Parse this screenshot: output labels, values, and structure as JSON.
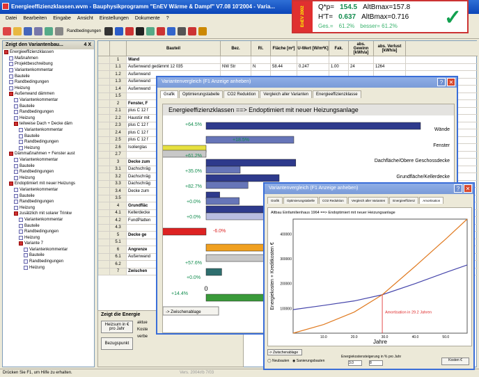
{
  "app": {
    "title": "Energieeffizienzklassen.wvm - Bauphysikprogramm \"EnEV Wärme & Dampf\" V7.08 10'2004 - Varia..."
  },
  "menu": [
    "Datei",
    "Bearbeiten",
    "Eingabe",
    "Ansicht",
    "Einstellungen",
    "Dokumente",
    "?"
  ],
  "toolbar": {
    "randbedingungen_label": "Randbedingungen"
  },
  "infobox": {
    "q_label": "Q*p=",
    "q_value": "154.5",
    "altb1_label": "AltBmax=157.8",
    "ht_label": "H'T=",
    "ht_value": "0.637",
    "altb2_label": "AltBmax=0.716",
    "ges_label": "Ges.=",
    "ges_value": "61.2%",
    "besser_label": "besser= 61.2%",
    "logo_text": "EnEV 2002"
  },
  "sidebar": {
    "title": "Zeigt den Variantenbau...",
    "pin": "4 X",
    "items": [
      {
        "label": "Energieeffizienzklassen",
        "indent": 0,
        "icon": "red"
      },
      {
        "label": "Maßnahmen",
        "indent": 1,
        "icon": "doc"
      },
      {
        "label": "Projektbeschreibung",
        "indent": 1,
        "icon": "doc"
      },
      {
        "label": "Variantenkommentar",
        "indent": 1,
        "icon": "doc"
      },
      {
        "label": "Bauteile",
        "indent": 1,
        "icon": "doc"
      },
      {
        "label": "Randbedingungen",
        "indent": 1,
        "icon": "doc"
      },
      {
        "label": "Heizung",
        "indent": 1,
        "icon": "doc"
      },
      {
        "label": "Außenwand dämmen",
        "indent": 1,
        "icon": "red"
      },
      {
        "label": "Variantenkommentar",
        "indent": 2,
        "icon": "doc"
      },
      {
        "label": "Bauteile",
        "indent": 2,
        "icon": "doc"
      },
      {
        "label": "Randbedingungen",
        "indent": 2,
        "icon": "doc"
      },
      {
        "label": "Heizung",
        "indent": 2,
        "icon": "doc"
      },
      {
        "label": "teilweise Dach + Decke däm",
        "indent": 2,
        "icon": "red"
      },
      {
        "label": "Variantenkommentar",
        "indent": 3,
        "icon": "doc"
      },
      {
        "label": "Bauteile",
        "indent": 3,
        "icon": "doc"
      },
      {
        "label": "Randbedingungen",
        "indent": 3,
        "icon": "doc"
      },
      {
        "label": "Heizung",
        "indent": 3,
        "icon": "doc"
      },
      {
        "label": "Dämmaßnahmen + Fenster aust",
        "indent": 1,
        "icon": "red"
      },
      {
        "label": "Variantenkommentar",
        "indent": 2,
        "icon": "doc"
      },
      {
        "label": "Bauteile",
        "indent": 2,
        "icon": "doc"
      },
      {
        "label": "Randbedingungen",
        "indent": 2,
        "icon": "doc"
      },
      {
        "label": "Heizung",
        "indent": 2,
        "icon": "doc"
      },
      {
        "label": "Endoptimiert mit neuer Heizungs",
        "indent": 1,
        "icon": "red"
      },
      {
        "label": "Variantenkommentar",
        "indent": 2,
        "icon": "doc"
      },
      {
        "label": "Bauteile",
        "indent": 2,
        "icon": "doc"
      },
      {
        "label": "Randbedingungen",
        "indent": 2,
        "icon": "doc"
      },
      {
        "label": "Heizung",
        "indent": 2,
        "icon": "doc"
      },
      {
        "label": "zusätzlich mit solarer Trinkw",
        "indent": 2,
        "icon": "red"
      },
      {
        "label": "Variantenkommentar",
        "indent": 3,
        "icon": "doc"
      },
      {
        "label": "Bauteile",
        "indent": 3,
        "icon": "doc"
      },
      {
        "label": "Randbedingungen",
        "indent": 3,
        "icon": "doc"
      },
      {
        "label": "Heizung",
        "indent": 3,
        "icon": "doc"
      },
      {
        "label": "Variante 7",
        "indent": 3,
        "icon": "red"
      },
      {
        "label": "Variantenkommentar",
        "indent": 4,
        "icon": "doc"
      },
      {
        "label": "Bauteile",
        "indent": 4,
        "icon": "doc"
      },
      {
        "label": "Randbedingungen",
        "indent": 4,
        "icon": "doc"
      },
      {
        "label": "Heizung",
        "indent": 4,
        "icon": "doc"
      }
    ]
  },
  "grid": {
    "headers": [
      "",
      "",
      "Bauteil",
      "Bez.",
      "Ri.",
      "Fläche [m²]",
      "U-Wert [W/m²K]",
      "Fak.",
      "abs. Gewinn [kWh/a]",
      "abs. Verlust [kWh/a]"
    ],
    "rows": [
      {
        "num": "1",
        "cells": [
          "Wand",
          "",
          "",
          "",
          "",
          "",
          "",
          ""
        ],
        "section": true
      },
      {
        "num": "1.1",
        "cells": [
          "Außenwand gedämmt 12 035",
          "NW Str",
          "N",
          "58.44",
          "0.247",
          "1.00",
          "24",
          "1264"
        ]
      },
      {
        "num": "1.2",
        "cells": [
          "Außenwand",
          "",
          "",
          "",
          "",
          "",
          "",
          ""
        ]
      },
      {
        "num": "1.3",
        "cells": [
          "Außenwand",
          "",
          "",
          "",
          "",
          "",
          "",
          ""
        ]
      },
      {
        "num": "1.4",
        "cells": [
          "Außenwand",
          "",
          "",
          "",
          "",
          "",
          "",
          ""
        ]
      },
      {
        "num": "1.5",
        "cells": [
          "",
          "",
          "",
          "",
          "",
          "",
          "",
          ""
        ]
      },
      {
        "num": "2",
        "cells": [
          "Fenster, F",
          "",
          "",
          "",
          "",
          "",
          "",
          ""
        ],
        "section": true
      },
      {
        "num": "2.1",
        "cells": [
          "plus C 12 f",
          "",
          "",
          "",
          "",
          "",
          "",
          ""
        ]
      },
      {
        "num": "2.2",
        "cells": [
          "Haustür mit",
          "",
          "",
          "",
          "",
          "",
          "",
          ""
        ]
      },
      {
        "num": "2.3",
        "cells": [
          "plus C 12 f",
          "",
          "",
          "",
          "",
          "",
          "",
          ""
        ]
      },
      {
        "num": "2.4",
        "cells": [
          "plus C 12 f",
          "",
          "",
          "",
          "",
          "",
          "",
          ""
        ]
      },
      {
        "num": "2.5",
        "cells": [
          "plus C 12 f",
          "",
          "",
          "",
          "",
          "",
          "",
          ""
        ]
      },
      {
        "num": "2.6",
        "cells": [
          "Isolierglas",
          "",
          "",
          "",
          "",
          "",
          "",
          ""
        ]
      },
      {
        "num": "2.7",
        "cells": [
          "",
          "",
          "",
          "",
          "",
          "",
          "",
          ""
        ]
      },
      {
        "num": "3",
        "cells": [
          "Decke zum",
          "",
          "",
          "",
          "",
          "",
          "",
          ""
        ],
        "section": true
      },
      {
        "num": "3.1",
        "cells": [
          "Dachschräg",
          "",
          "",
          "",
          "",
          "",
          "",
          ""
        ]
      },
      {
        "num": "3.2",
        "cells": [
          "Dachschräg",
          "",
          "",
          "",
          "",
          "",
          "",
          ""
        ]
      },
      {
        "num": "3.3",
        "cells": [
          "Dachschräg",
          "",
          "",
          "",
          "",
          "",
          "",
          ""
        ]
      },
      {
        "num": "3.4",
        "cells": [
          "Decke zum",
          "",
          "",
          "",
          "",
          "",
          "",
          ""
        ]
      },
      {
        "num": "3.5",
        "cells": [
          "",
          "",
          "",
          "",
          "",
          "",
          "",
          ""
        ]
      },
      {
        "num": "4",
        "cells": [
          "Grundfläc",
          "",
          "",
          "",
          "",
          "",
          "",
          ""
        ],
        "section": true
      },
      {
        "num": "4.1",
        "cells": [
          "Kellerdecke",
          "",
          "",
          "",
          "",
          "",
          "",
          ""
        ]
      },
      {
        "num": "4.2",
        "cells": [
          "FundPlatten",
          "",
          "",
          "",
          "",
          "",
          "",
          ""
        ]
      },
      {
        "num": "4.3",
        "cells": [
          "",
          "",
          "",
          "",
          "",
          "",
          "",
          ""
        ]
      },
      {
        "num": "5",
        "cells": [
          "Decke ge",
          "",
          "",
          "",
          "",
          "",
          "",
          ""
        ],
        "section": true
      },
      {
        "num": "5.1",
        "cells": [
          "",
          "",
          "",
          "",
          "",
          "",
          "",
          ""
        ]
      },
      {
        "num": "6",
        "cells": [
          "Angrenze",
          "",
          "",
          "",
          "",
          "",
          "",
          ""
        ],
        "section": true
      },
      {
        "num": "6.1",
        "cells": [
          "Außenwand",
          "",
          "",
          "",
          "",
          "",
          "",
          ""
        ]
      },
      {
        "num": "6.2",
        "cells": [
          "",
          "",
          "",
          "",
          "",
          "",
          "",
          ""
        ]
      },
      {
        "num": "7",
        "cells": [
          "Zwischen",
          "",
          "",
          "",
          "",
          "",
          "",
          ""
        ],
        "section": true
      }
    ]
  },
  "bottom": {
    "title": "Zeigt die Energie",
    "btn_heizsum": "Heizsum in € pro Jahr",
    "btn_bezug": "Bezugspunkt",
    "text_aktu": "aktue",
    "text_koste": "Koste",
    "text_verb": "verbe"
  },
  "status": {
    "text": "Drücken Sie F1, um Hilfe zu erhalten.",
    "right": "Vers. 2004r/b 7/03"
  },
  "win1": {
    "title": "Variantenvergleich                     (F1 Anzeige anheben)",
    "tabs": [
      "Grafik",
      "Optimierungstabelle",
      "CO2 Reduktion",
      "Vergleich aller Varianten",
      "Energieeffizienzklasse"
    ],
    "chart_title": "Energieeffizienzklassen ==> Endoptimiert mit neuer Heizungsanlage",
    "button_zwischen": "-> Zwischenablage",
    "bottom_label": "(%) da"
  },
  "chart_data": [
    {
      "type": "bar",
      "title": "Energieeffizienzklassen ==> Endoptimiert mit neuer Heizungsanlage",
      "categories": [
        "Wände",
        "Fenster",
        "Dachfläche/Obere Geschossdecke",
        "Grundfläche/Kellerdecke",
        "",
        "",
        "",
        "",
        ""
      ],
      "pct_labels": [
        "+64.5%",
        "+18.5%",
        "+61.2%",
        "+35.0%",
        "+82.7%",
        "+0.0%",
        "+0.0%",
        "-6.0%",
        "+57.6%",
        "+0.0%",
        "+14.4%"
      ],
      "xticks": [
        "0",
        "10000",
        "20000"
      ],
      "xlim": [
        0,
        25000
      ],
      "bars": [
        {
          "value": 22000,
          "color": "#2e3a8c"
        },
        {
          "value": 9000,
          "color": "#6675b8"
        },
        {
          "value": -8000,
          "color": "#e6e040"
        },
        {
          "value": -4500,
          "color": "#c8c8c8"
        },
        {
          "value": 9200,
          "color": "#2e3a8c"
        },
        {
          "value": 3500,
          "color": "#6675b8"
        },
        {
          "value": 7500,
          "color": "#2e3a8c"
        },
        {
          "value": 4300,
          "color": "#6675b8"
        },
        {
          "value": 1400,
          "color": "#2e3a8c"
        },
        {
          "value": 3400,
          "color": "#6675b8"
        },
        {
          "value": 7000,
          "color": "#2e3a8c"
        },
        {
          "value": 6000,
          "color": "#b8bce0"
        },
        {
          "value": -5000,
          "color": "#dd2222"
        },
        {
          "value": 20000,
          "color": "#f0a020"
        },
        {
          "value": 18000,
          "color": "#c8c8c8"
        },
        {
          "value": 1600,
          "color": "#2e6e6e"
        },
        {
          "value": 25000,
          "color": "#3a9a3a"
        }
      ]
    },
    {
      "type": "line",
      "title": "Altbau Einfamilienhaus 1964 ==> Endoptimiert mit neuer Heizungsanlage",
      "xlabel": "Jahre",
      "ylabel": "Energiekosten + Kreditkosten €",
      "xticks": [
        "10.0",
        "20.0",
        "30.0",
        "40.0",
        "50.0"
      ],
      "yticks": [
        "100000",
        "200000",
        "300000",
        "400000"
      ],
      "xlim": [
        0,
        57
      ],
      "ylim": [
        0,
        460000
      ],
      "annotation": "Amortisation in 29.2 Jahren",
      "series": [
        {
          "values": [
            [
              0,
              95000
            ],
            [
              10,
              112000
            ],
            [
              20,
              130000
            ],
            [
              29.2,
              155000
            ],
            [
              40,
              200000
            ],
            [
              50,
              245000
            ],
            [
              57,
              275000
            ]
          ],
          "color": "#4444aa"
        },
        {
          "values": [
            [
              0,
              0
            ],
            [
              10,
              35000
            ],
            [
              20,
              85000
            ],
            [
              29.2,
              155000
            ],
            [
              40,
              270000
            ],
            [
              50,
              380000
            ],
            [
              57,
              460000
            ]
          ],
          "color": "#e07a20"
        }
      ]
    }
  ],
  "win2": {
    "title": "Variantenvergleich                (F1 Anzeige anheben)",
    "tabs": [
      "Grafik",
      "Optimierungstabelle",
      "CO2 Reduktion",
      "Vergleich aller Varianten",
      "Energieeffizienz",
      "Amortisation"
    ],
    "btn_zwischen": "-> Zwischenablage",
    "radio1": "Neubauten",
    "radio2": "Sanierungsbauten",
    "field_label": "Energiekostensteigerung in % pro Jahr",
    "field_value": "3.0",
    "field_value2": "8",
    "btn_right": "Kosten €"
  }
}
